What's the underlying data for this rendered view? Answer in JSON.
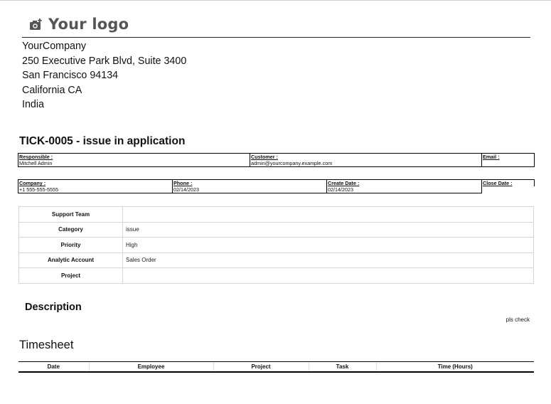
{
  "logo": {
    "text": "Your logo",
    "icon": "camera-icon"
  },
  "company": {
    "name": "YourCompany",
    "street": "250 Executive Park Blvd, Suite 3400",
    "city": "San Francisco 94134",
    "state": "California CA",
    "country": "India"
  },
  "ticket": {
    "title": "TICK-0005 - issue in application"
  },
  "info_row_1": {
    "responsible_label": "Responsible :",
    "responsible_value": "Mitchell Admin",
    "customer_label": "Customer :",
    "customer_value": "admin@yourcompany.example.com",
    "email_label": "Email :",
    "email_value": ""
  },
  "info_row_2": {
    "company_label": "Company :",
    "company_value": "+1 555-555-5555",
    "phone_label": "Phone :",
    "phone_value": "02/14/2023",
    "create_date_label": "Create Date :",
    "create_date_value": "02/14/2023",
    "close_date_label": "Close Date :"
  },
  "details": [
    {
      "label": "Support Team",
      "value": ""
    },
    {
      "label": "Category",
      "value": "issue"
    },
    {
      "label": "Priority",
      "value": "High"
    },
    {
      "label": "Analytic Account",
      "value": "Sales Order"
    },
    {
      "label": "Project",
      "value": ""
    }
  ],
  "description": {
    "heading": "Description",
    "text": "pls check"
  },
  "timesheet": {
    "heading": "Timesheet",
    "columns": [
      "Date",
      "Employee",
      "Project",
      "Task",
      "Time (Hours)"
    ]
  }
}
